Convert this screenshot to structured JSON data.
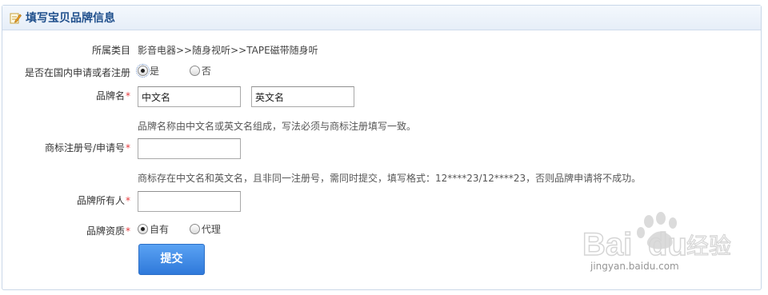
{
  "panel": {
    "title": "填写宝贝品牌信息"
  },
  "form": {
    "category": {
      "label": "所属类目",
      "value": "影音电器>>随身视听>>TAPE磁带随身听"
    },
    "domestic": {
      "label": "是否在国内申请或者注册",
      "options": [
        "是",
        "否"
      ],
      "selected": "是"
    },
    "brand_name": {
      "label": "品牌名",
      "required_mark": "*",
      "cn_value": "中文名",
      "en_value": "英文名",
      "hint": "品牌名称由中文名或英文名组成，写法必须与商标注册填写一致。"
    },
    "trademark_no": {
      "label": "商标注册号/申请号",
      "required_mark": "*",
      "value": "",
      "hint": "商标存在中文名和英文名，且非同一注册号，需同时提交，填写格式：12****23/12****23，否则品牌申请将不成功。"
    },
    "owner": {
      "label": "品牌所有人",
      "required_mark": "*",
      "value": ""
    },
    "qualification": {
      "label": "品牌资质",
      "required_mark": "*",
      "options": [
        "自有",
        "代理"
      ],
      "selected": "自有"
    },
    "submit_label": "提交"
  },
  "watermark": {
    "brand": "Baidu经验",
    "url": "jingyan.baidu.com"
  }
}
